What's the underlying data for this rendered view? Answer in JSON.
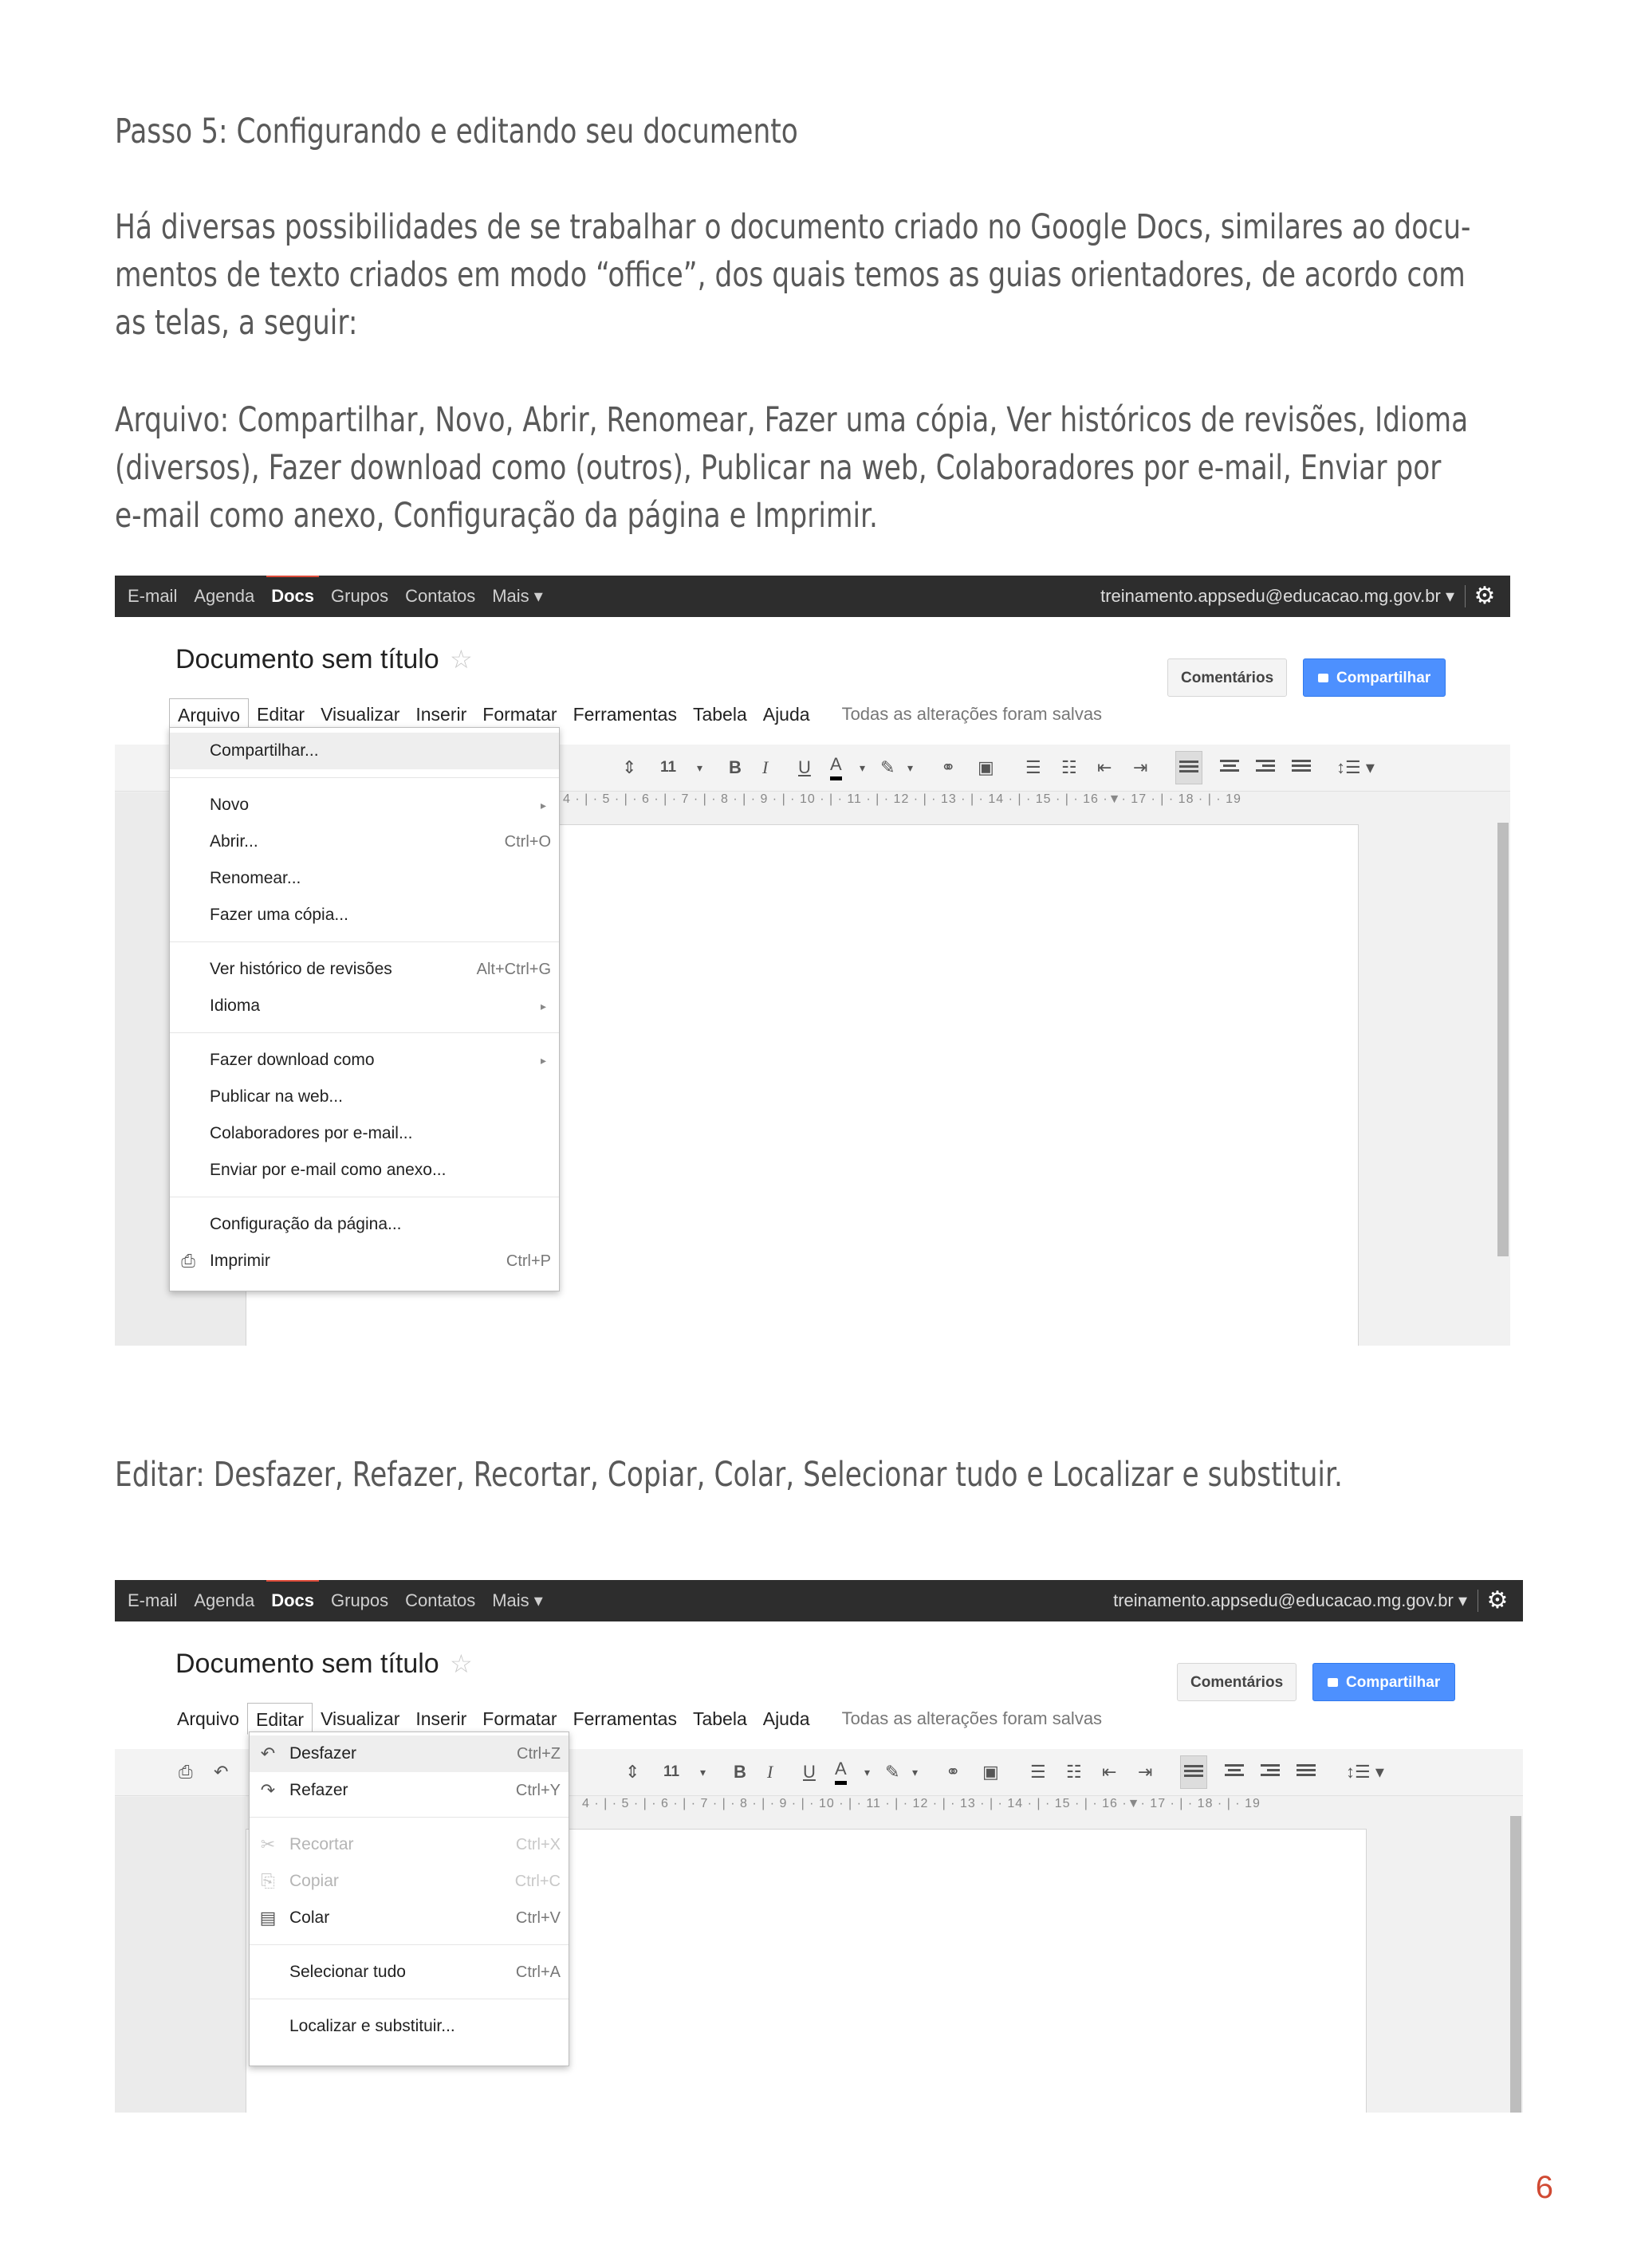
{
  "prose": {
    "heading": "Passo 5: Configurando e editando seu documento",
    "intro": [
      "Há diversas possibilidades de se trabalhar o documento criado no Google Docs, similares ao docu-",
      "mentos de texto criados em modo “office”, dos quais temos as guias orientadores, de acordo com",
      "as telas, a seguir:"
    ],
    "arquivo_desc": [
      "Arquivo: Compartilhar, Novo, Abrir, Renomear, Fazer uma cópia, Ver históricos de revisões, Idioma",
      "(diversos), Fazer download como (outros), Publicar na web, Colaboradores por e-mail, Enviar por",
      "e-mail como anexo, Configuração da página e Imprimir."
    ],
    "editar_desc": "Editar: Desfazer, Refazer, Recortar, Copiar, Colar, Selecionar tudo e Localizar e substituir."
  },
  "page_number": "6",
  "app": {
    "nav": [
      "E-mail",
      "Agenda",
      "Docs",
      "Grupos",
      "Contatos",
      "Mais ▾"
    ],
    "account": "treinamento.appsedu@educacao.mg.gov.br ▾",
    "doc_title": "Documento sem título",
    "comments_button": "Comentários",
    "share_button": "Compartilhar",
    "menus": [
      "Arquivo",
      "Editar",
      "Visualizar",
      "Inserir",
      "Formatar",
      "Ferramentas",
      "Tabela",
      "Ajuda"
    ],
    "saved_status": "Todas as alterações foram salvas",
    "font_size": "11",
    "ruler": "4 · | · 5 · | · 6 · | · 7 · | · 8 · | · 9 · | · 10 · | · 11 · | · 12 · | · 13 · | · 14 · | · 15 · | · 16 ·▼· 17 · | · 18 · | · 19"
  },
  "arquivo_menu": [
    {
      "label": "Compartilhar...",
      "shortcut": "",
      "submenu": false,
      "icon": ""
    },
    {
      "label": "Novo",
      "shortcut": "",
      "submenu": true,
      "icon": ""
    },
    {
      "label": "Abrir...",
      "shortcut": "Ctrl+O",
      "submenu": false,
      "icon": ""
    },
    {
      "label": "Renomear...",
      "shortcut": "",
      "submenu": false,
      "icon": ""
    },
    {
      "label": "Fazer uma cópia...",
      "shortcut": "",
      "submenu": false,
      "icon": ""
    },
    {
      "label": "Ver histórico de revisões",
      "shortcut": "Alt+Ctrl+G",
      "submenu": false,
      "icon": ""
    },
    {
      "label": "Idioma",
      "shortcut": "",
      "submenu": true,
      "icon": ""
    },
    {
      "label": "Fazer download como",
      "shortcut": "",
      "submenu": true,
      "icon": ""
    },
    {
      "label": "Publicar na web...",
      "shortcut": "",
      "submenu": false,
      "icon": ""
    },
    {
      "label": "Colaboradores por e-mail...",
      "shortcut": "",
      "submenu": false,
      "icon": ""
    },
    {
      "label": "Enviar por e-mail como anexo...",
      "shortcut": "",
      "submenu": false,
      "icon": ""
    },
    {
      "label": "Configuração da página...",
      "shortcut": "",
      "submenu": false,
      "icon": ""
    },
    {
      "label": "Imprimir",
      "shortcut": "Ctrl+P",
      "submenu": false,
      "icon": "printer-icon"
    }
  ],
  "editar_menu": [
    {
      "label": "Desfazer",
      "shortcut": "Ctrl+Z",
      "disabled": false,
      "icon": "undo-icon"
    },
    {
      "label": "Refazer",
      "shortcut": "Ctrl+Y",
      "disabled": false,
      "icon": "redo-icon"
    },
    {
      "label": "Recortar",
      "shortcut": "Ctrl+X",
      "disabled": true,
      "icon": "scissors-icon"
    },
    {
      "label": "Copiar",
      "shortcut": "Ctrl+C",
      "disabled": true,
      "icon": "copy-icon"
    },
    {
      "label": "Colar",
      "shortcut": "Ctrl+V",
      "disabled": false,
      "icon": "paste-icon"
    },
    {
      "label": "Selecionar tudo",
      "shortcut": "Ctrl+A",
      "disabled": false,
      "icon": ""
    },
    {
      "label": "Localizar e substituir...",
      "shortcut": "",
      "disabled": false,
      "icon": ""
    }
  ]
}
